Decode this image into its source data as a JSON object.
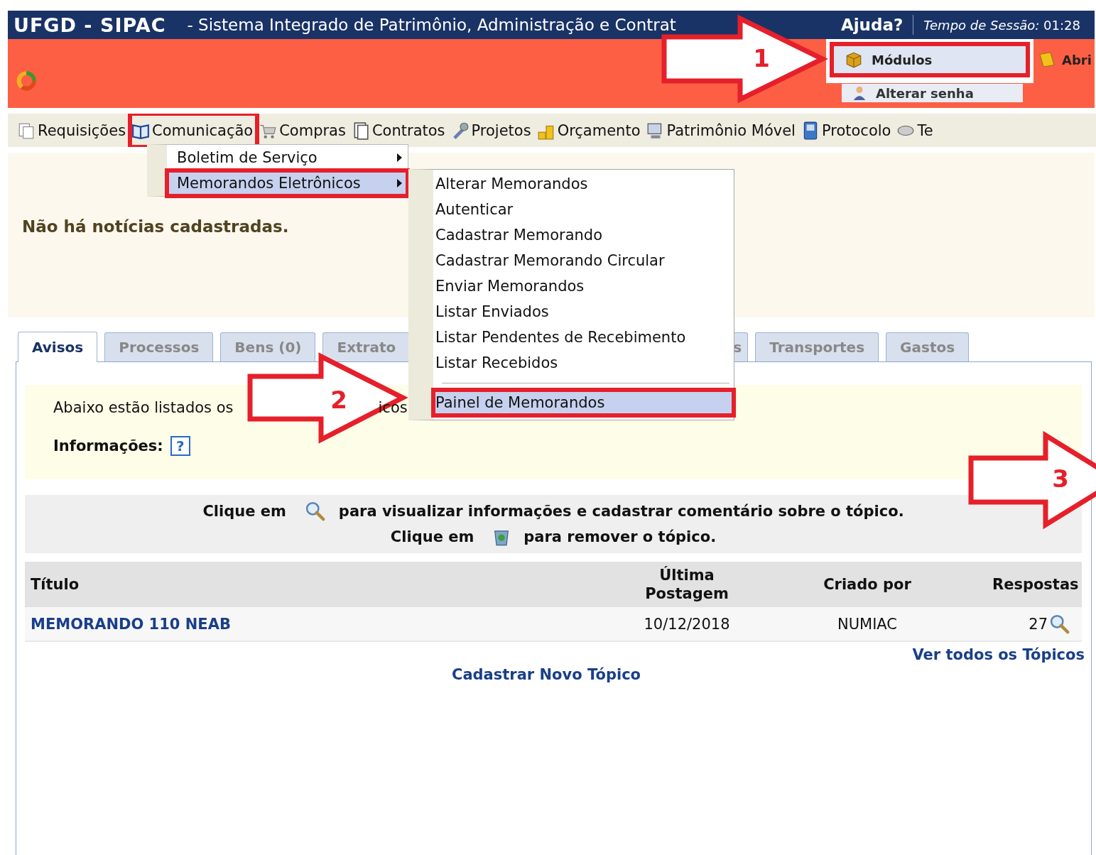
{
  "header": {
    "title": "UFGD - SIPAC",
    "subtitle": "- Sistema Integrado de Patrimônio, Administração e Contrat",
    "help": "Ajuda?",
    "session": "*Tempo de Sessão:* 01:28"
  },
  "user_menu": [
    {
      "label": "Módulos",
      "highlighted": true
    },
    {
      "label": "Alterar senha",
      "highlighted": false
    }
  ],
  "open_link": "Abri",
  "menu": [
    {
      "label": "Requisições",
      "highlighted": false
    },
    {
      "label": "Comunicação",
      "highlighted": true
    },
    {
      "label": "Compras",
      "highlighted": false
    },
    {
      "label": "Contratos",
      "highlighted": false
    },
    {
      "label": "Projetos",
      "highlighted": false
    },
    {
      "label": "Orçamento",
      "highlighted": false
    },
    {
      "label": "Patrimônio Móvel",
      "highlighted": false
    },
    {
      "label": "Protocolo",
      "highlighted": false
    },
    {
      "label": "Te",
      "highlighted": false
    }
  ],
  "dropdown": [
    {
      "label": "Boletim de Serviço",
      "selected": false,
      "highlighted": false
    },
    {
      "label": "Memorandos Eletrônicos",
      "selected": true,
      "highlighted": true
    }
  ],
  "submenu_groups": [
    [
      {
        "label": "Alterar Memorandos",
        "selected": false,
        "highlighted": false
      },
      {
        "label": "Autenticar",
        "selected": false,
        "highlighted": false
      },
      {
        "label": "Cadastrar Memorando",
        "selected": false,
        "highlighted": false
      },
      {
        "label": "Cadastrar Memorando Circular",
        "selected": false,
        "highlighted": false
      },
      {
        "label": "Enviar Memorandos",
        "selected": false,
        "highlighted": false
      },
      {
        "label": "Listar Enviados",
        "selected": false,
        "highlighted": false
      },
      {
        "label": "Listar Pendentes de Recebimento",
        "selected": false,
        "highlighted": false
      },
      {
        "label": "Listar Recebidos",
        "selected": false,
        "highlighted": false
      }
    ],
    [
      {
        "label": "Painel de Memorandos",
        "selected": true,
        "highlighted": true
      }
    ]
  ],
  "news": "Não há notícias cadastradas.",
  "tabs": [
    {
      "label": "Avisos",
      "selected": true
    },
    {
      "label": "Processos",
      "selected": false
    },
    {
      "label": "Bens (0)",
      "selected": false
    },
    {
      "label": "Extrato",
      "selected": false
    },
    {
      "label": "s",
      "selected": false
    },
    {
      "label": "Transportes",
      "selected": false
    },
    {
      "label": "Gastos",
      "selected": false
    }
  ],
  "info": {
    "text_start": "Abaixo estão listados os",
    "text_end": "icos",
    "label": "Informações:",
    "help_icon": "?"
  },
  "instructions": [
    {
      "before": "Clique em",
      "after": "para visualizar informações e cadastrar comentário sobre o tópico."
    },
    {
      "before": "Clique em",
      "after": "para remover o tópico."
    }
  ],
  "table": {
    "columns": [
      "Título",
      "Última Postagem",
      "Criado por",
      "Respostas"
    ],
    "rows": [
      {
        "title": "MEMORANDO 110 NEAB",
        "last_post": "10/12/2018",
        "created_by": "NUMIAC",
        "replies": "27"
      }
    ]
  },
  "links": {
    "all_topics": "Ver todos os Tópicos",
    "new_topic": "Cadastrar Novo Tópico"
  },
  "annotations": [
    {
      "number": "1"
    },
    {
      "number": "2"
    },
    {
      "number": "3"
    }
  ]
}
